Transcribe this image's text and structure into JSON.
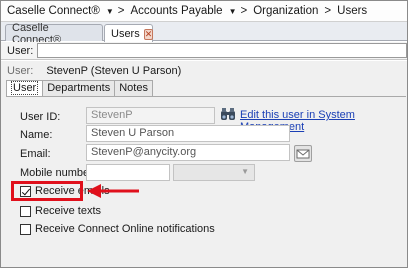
{
  "breadcrumb": {
    "items": [
      "Caselle Connect®",
      "Accounts Payable",
      "Organization",
      "Users"
    ],
    "separator": ">"
  },
  "tabs": [
    {
      "label": "Caselle Connect®",
      "active": false
    },
    {
      "label": "Users",
      "active": true
    }
  ],
  "search": {
    "label": "User:",
    "value": ""
  },
  "user_header": {
    "key": "User:",
    "value": "StevenP  (Steven U Parson)"
  },
  "subtabs": [
    "User",
    "Departments",
    "Notes"
  ],
  "form": {
    "user_id_label": "User ID:",
    "user_id_value": "StevenP",
    "edit_link": "Edit this user in System Management",
    "name_label": "Name:",
    "name_value": "Steven U Parson",
    "email_label": "Email:",
    "email_value": "StevenP@anycity.org",
    "mobile_label": "Mobile number:",
    "mobile_value": "",
    "carrier_value": ""
  },
  "options": [
    {
      "label": "Receive emails",
      "checked": true
    },
    {
      "label": "Receive texts",
      "checked": false
    },
    {
      "label": "Receive Connect Online notifications",
      "checked": false
    }
  ],
  "annotation": {
    "highlight_color": "#e0101c",
    "arrow_color": "#e0101c"
  }
}
